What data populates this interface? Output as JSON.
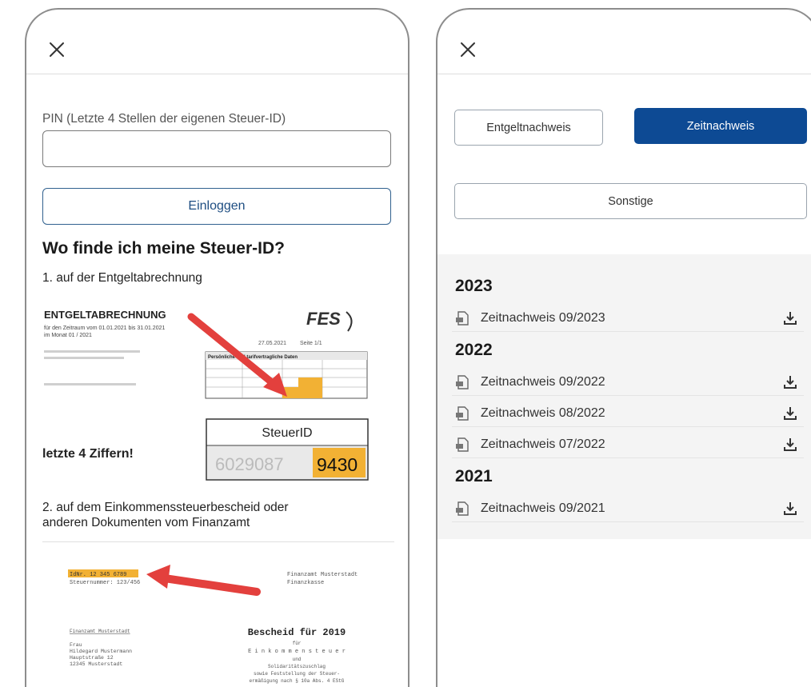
{
  "login_screen": {
    "pin_label": "PIN (Letzte 4 Stellen der eigenen Steuer-ID)",
    "pin_value": "",
    "login_button": "Einloggen",
    "faq_title": "Wo finde ich meine Steuer-ID?",
    "step1": "1.  auf der Entgeltabrechnung",
    "step2_line1": "2.  auf dem Einkommenssteuerbescheid oder",
    "step2_line2": "anderen Dokumenten vom Finanzamt",
    "example_payslip": {
      "title": "ENTGELTABRECHNUNG",
      "period": "für den Zeitraum vom 01.01.2021 bis 31.01.2021",
      "month": "im Monat 01 / 2021",
      "logo": "FES",
      "date": "27.05.2021",
      "page": "Seite 1/1",
      "box_header": "Persönliche und tarifvertragliche Daten",
      "steuerid_label": "SteuerID",
      "steuerid_blurred": "6029087",
      "steuerid_digits": "9430",
      "hint": "letzte 4 Ziffern!"
    },
    "example_notice": {
      "idnr": "IdNr. 12 345 6789",
      "steuernummer": "Steuernummer: 123/456",
      "finanzamt": "Finanzamt Musterstadt",
      "finanzkasse": "Finanzkasse",
      "sender": "Finanzamt Musterstadt",
      "addressee_lines": [
        "Frau",
        "Hildegard Mustermann",
        "Hauptstraße 12",
        "12345 Musterstadt"
      ],
      "heading": "Bescheid für 2019",
      "sub_lines": [
        "für",
        "E i n k o m m e n s t e u e r",
        "und",
        "Solidaritätszuschlag",
        "sowie Feststellung der Steuer-",
        "ermäßigung nach § 10a Abs. 4 EStG"
      ]
    }
  },
  "documents_screen": {
    "tabs": [
      "Entgeltnachweis",
      "Zeitnachweis"
    ],
    "active_tab": "Zeitnachweis",
    "other_button": "Sonstige",
    "groups": [
      {
        "year": "2023",
        "items": [
          "Zeitnachweis 09/2023"
        ]
      },
      {
        "year": "2022",
        "items": [
          "Zeitnachweis 09/2022",
          "Zeitnachweis 08/2022",
          "Zeitnachweis 07/2022"
        ]
      },
      {
        "year": "2021",
        "items": [
          "Zeitnachweis 09/2021"
        ]
      }
    ]
  },
  "icons": {
    "close": "close-icon",
    "document": "pdf-document-icon",
    "download": "download-icon"
  },
  "colors": {
    "primary": "#0d4a94",
    "highlight": "#f2b134",
    "arrow": "#e3403d"
  }
}
